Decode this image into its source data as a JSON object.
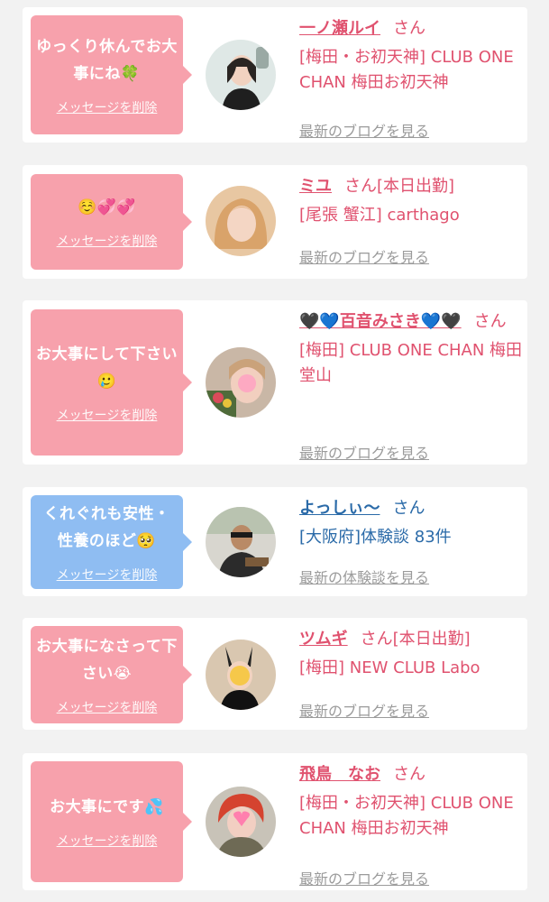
{
  "delete_label": "メッセージを削除",
  "items": [
    {
      "message": "ゆっくり休んでお大事にね🍀",
      "name": "一ノ瀬ルイ",
      "suffix": "さん",
      "shop": "[梅田・お初天神] CLUB ONE CHAN 梅田お初天神",
      "link": "最新のブログを見る",
      "bubble_color": "#f7a1ac"
    },
    {
      "message": "☺️💞💞",
      "name": "ミユ",
      "suffix": "さん[本日出勤]",
      "shop": "[尾張 蟹江] carthago",
      "link": "最新のブログを見る",
      "bubble_color": "#f7a1ac"
    },
    {
      "message": "お大事にして下さい🥲",
      "name": "🖤💙百音みさき💙🖤",
      "suffix": "さん",
      "shop": "[梅田] CLUB ONE CHAN 梅田堂山",
      "link": "最新のブログを見る",
      "bubble_color": "#f7a1ac"
    },
    {
      "message": "くれぐれも安性・性養のほど🥺",
      "name": "よっしぃ〜",
      "suffix": "さん",
      "shop": "[大阪府]体験談 83件",
      "link": "最新の体験談を見る",
      "bubble_color": "#8fbdf2"
    },
    {
      "message": "お大事になさって下さい😭",
      "name": "ツムギ",
      "suffix": "さん[本日出勤]",
      "shop": "[梅田] NEW CLUB Labo",
      "link": "最新のブログを見る",
      "bubble_color": "#f7a1ac"
    },
    {
      "message": "お大事にです💦",
      "name": "飛鳥　なお",
      "suffix": "さん",
      "shop": "[梅田・お初天神] CLUB ONE CHAN 梅田お初天神",
      "link": "最新のブログを見る",
      "bubble_color": "#f7a1ac"
    }
  ]
}
